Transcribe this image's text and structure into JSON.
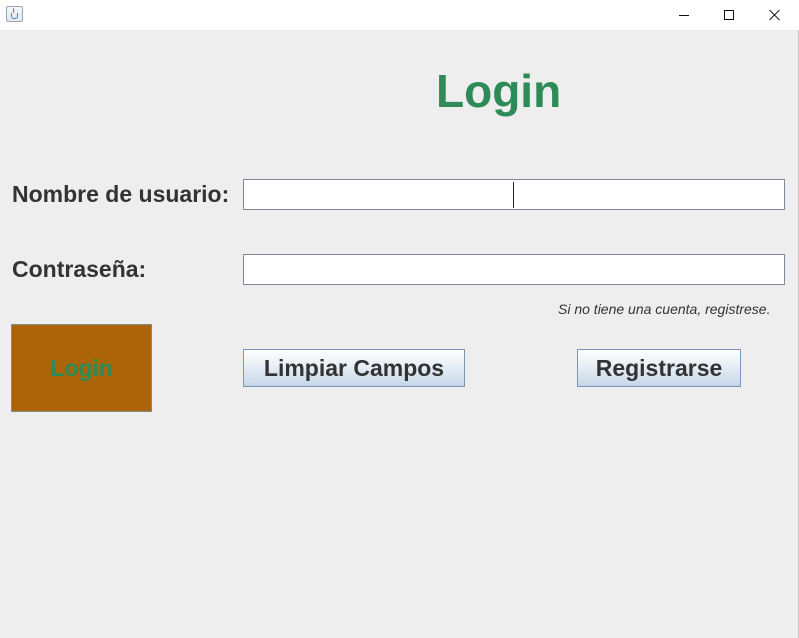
{
  "window": {
    "controls": {
      "minimize_icon": "minimize-icon",
      "maximize_icon": "maximize-icon",
      "close_icon": "close-icon"
    },
    "app_icon": "java-cup-icon"
  },
  "form": {
    "title": "Login",
    "username_label": "Nombre de usuario:",
    "username_value": "",
    "password_label": "Contraseña:",
    "password_value": "",
    "register_hint": "Si no tiene una cuenta, registrese.",
    "login_button": "Login",
    "clear_button": "Limpiar Campos",
    "register_button": "Registrarse"
  },
  "colors": {
    "title": "#2e8b57",
    "login_button_bg": "#ac6408",
    "login_button_text": "#2e8b57",
    "background": "#eeeeee"
  }
}
